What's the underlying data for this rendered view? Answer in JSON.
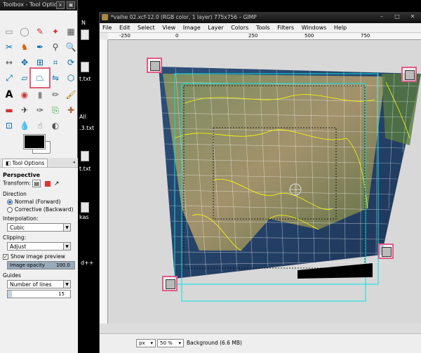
{
  "desktop": {
    "labels": [
      "N",
      "t.txt",
      "All",
      ".3.txt",
      "t.txt",
      "kas",
      "d++"
    ]
  },
  "toolbox": {
    "title": "Toolbox - Tool Options",
    "close_glyph": "x",
    "dock_glyph": "▣"
  },
  "tool_options": {
    "tab_label": "Tool Options",
    "heading": "Perspective",
    "transform_label": "Transform:",
    "direction_label": "Direction",
    "direction_normal": "Normal (Forward)",
    "direction_corrective": "Corrective (Backward)",
    "interpolation_label": "Interpolation:",
    "interpolation_value": "Cubic",
    "clipping_label": "Clipping:",
    "clipping_value": "Adjust",
    "show_preview_label": "Show image preview",
    "opacity_label": "Image opacity",
    "opacity_value": "100.0",
    "opacity_fraction": 1.0,
    "guides_label": "Guides",
    "guides_value": "Number of lines",
    "lines_value": "15"
  },
  "gimp": {
    "title": "*vaihe 02.xcf-12.0 (RGB color, 1 layer) 775x756 – GIMP",
    "menu": [
      "File",
      "Edit",
      "Select",
      "View",
      "Image",
      "Layer",
      "Colors",
      "Tools",
      "Filters",
      "Windows",
      "Help"
    ],
    "ruler_ticks": [
      "-250",
      "0",
      "250",
      "500",
      "750"
    ],
    "unit": "px",
    "zoom": "50 %",
    "status": "Background (6.6 MB)"
  },
  "colors": {
    "highlight": "#e05b8a",
    "guides": "#00e5e5",
    "borders": "#ffff00"
  }
}
